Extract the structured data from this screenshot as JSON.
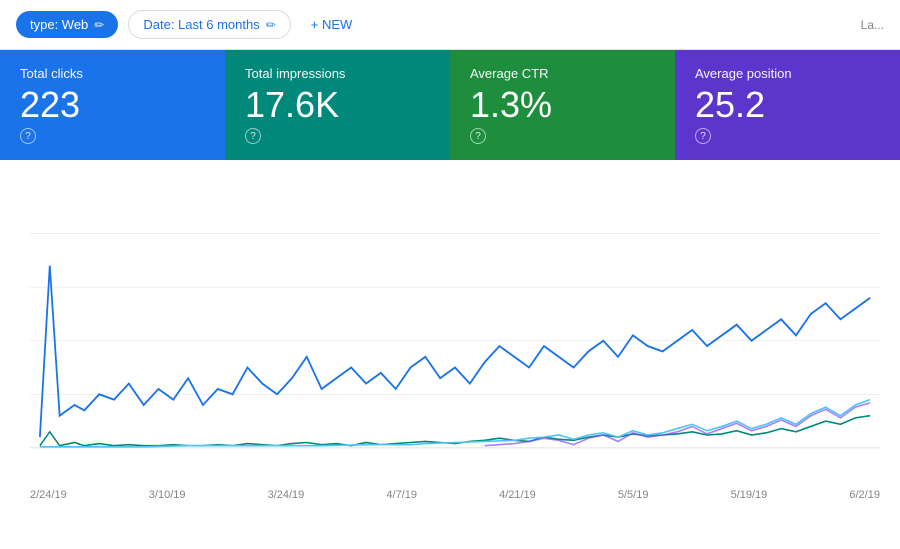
{
  "toolbar": {
    "type_filter_label": "type: Web",
    "date_filter_label": "Date: Last 6 months",
    "new_button_label": "+ NEW",
    "right_label": "La..."
  },
  "metrics": [
    {
      "id": "total-clicks",
      "label": "Total clicks",
      "value": "223",
      "color": "blue"
    },
    {
      "id": "total-impressions",
      "label": "Total impressions",
      "value": "17.6K",
      "color": "teal"
    },
    {
      "id": "average-ctr",
      "label": "Average CTR",
      "value": "1.3%",
      "color": "green"
    },
    {
      "id": "average-position",
      "label": "Average position",
      "value": "25.2",
      "color": "purple"
    }
  ],
  "chart": {
    "x_labels": [
      "2/24/19",
      "3/10/19",
      "3/24/19",
      "4/7/19",
      "4/21/19",
      "5/5/19",
      "5/19/19",
      "6/2/19"
    ]
  }
}
